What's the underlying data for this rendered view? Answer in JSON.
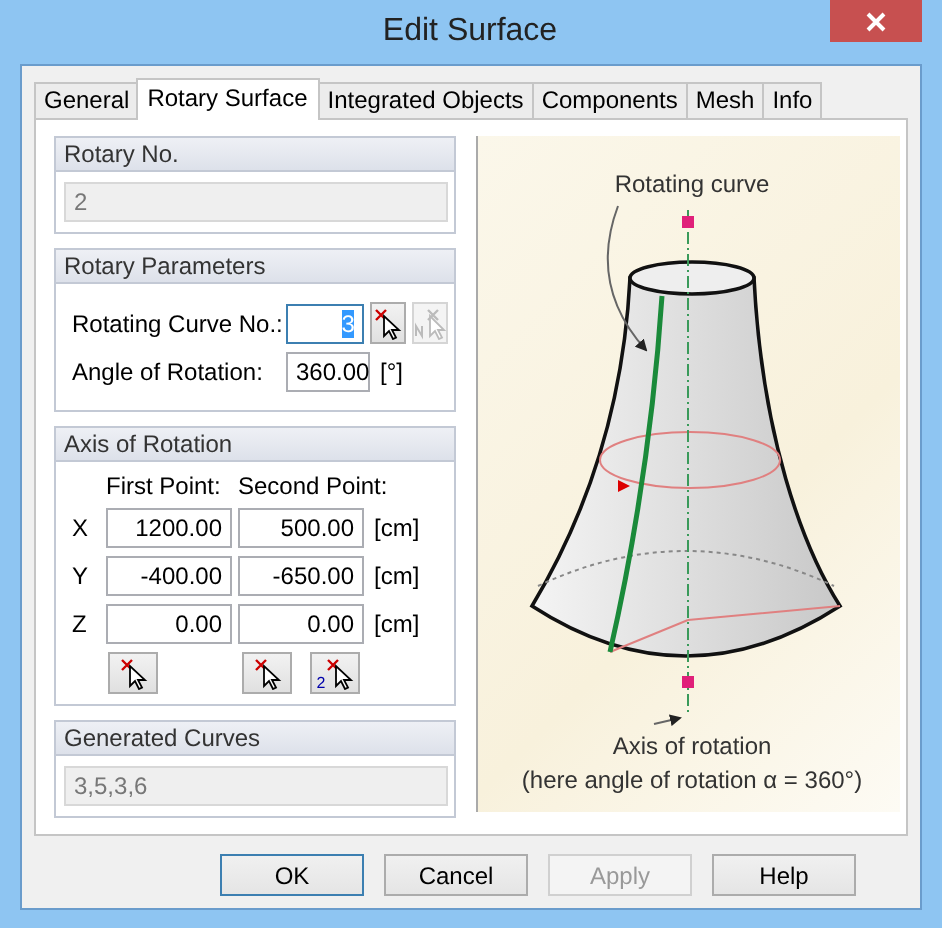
{
  "window": {
    "title": "Edit Surface"
  },
  "tabs": [
    {
      "label": "General",
      "selected": false
    },
    {
      "label": "Rotary Surface",
      "selected": true
    },
    {
      "label": "Integrated Objects",
      "selected": false
    },
    {
      "label": "Components",
      "selected": false
    },
    {
      "label": "Mesh",
      "selected": false
    },
    {
      "label": "Info",
      "selected": false
    }
  ],
  "rotary_no": {
    "title": "Rotary No.",
    "value": "2",
    "disabled": true
  },
  "rotary_parameters": {
    "title": "Rotary Parameters",
    "rotating_curve": {
      "label": "Rotating Curve No.:",
      "value": "3",
      "text_selected": true
    },
    "angle": {
      "label": "Angle of Rotation:",
      "value": "360.00",
      "unit": "[°]"
    }
  },
  "axis_of_rotation": {
    "title": "Axis of Rotation",
    "pick_number": "2",
    "first_point_label": "First Point:",
    "second_point_label": "Second Point:",
    "rows": [
      {
        "axis": "X",
        "first": "1200.00",
        "second": "500.00",
        "unit": "[cm]"
      },
      {
        "axis": "Y",
        "first": "-400.00",
        "second": "-650.00",
        "unit": "[cm]"
      },
      {
        "axis": "Z",
        "first": "0.00",
        "second": "0.00",
        "unit": "[cm]"
      }
    ]
  },
  "generated_curves": {
    "title": "Generated Curves",
    "value": "3,5,3,6",
    "disabled": true
  },
  "diagram": {
    "curve_label": "Rotating curve",
    "axis_label": "Axis of rotation",
    "angle_note": "(here angle of rotation α = 360°)"
  },
  "buttons": [
    {
      "label": "OK",
      "default": true,
      "disabled": false
    },
    {
      "label": "Cancel",
      "default": false,
      "disabled": false
    },
    {
      "label": "Apply",
      "default": false,
      "disabled": true
    },
    {
      "label": "Help",
      "default": false,
      "disabled": false
    }
  ]
}
